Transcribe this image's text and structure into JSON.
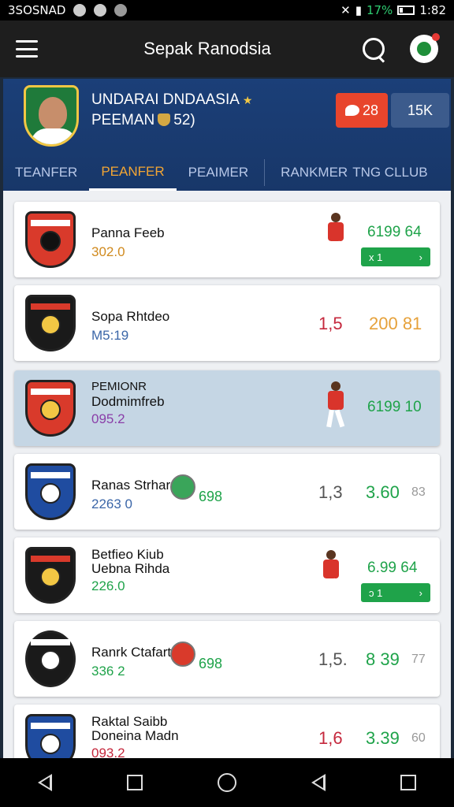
{
  "status_bar": {
    "carrier": "3SOSNAD",
    "battery_percent": "17%",
    "time": "1:82",
    "icons": [
      "notification-icon",
      "record-icon",
      "android-icon",
      "mute-icon",
      "signal-icon",
      "battery-icon"
    ]
  },
  "header": {
    "title": "Sepak Ranodsia",
    "icons": [
      "menu-icon",
      "search-icon",
      "profile-icon"
    ]
  },
  "banner": {
    "line1": "UNDARAI DNDAASIA",
    "line2_prefix": "PEEMAN",
    "line2_suffix": "52)",
    "twitter_count": "28",
    "follow_label": "15K"
  },
  "tabs": [
    {
      "label": "TEANFER",
      "active": false
    },
    {
      "label": "PEANFER",
      "active": true
    },
    {
      "label": "PEAIMER",
      "active": false
    },
    {
      "label": "RANKMER",
      "active": false
    },
    {
      "label": "TNG CLLUB",
      "active": false
    }
  ],
  "cards": [
    {
      "name1": "Panna Feeb",
      "name2": "",
      "sub": "302.0",
      "sub_color": "#d08a1e",
      "stat1": "",
      "stat2": "6199 64",
      "stat2_color": "#1fa34a",
      "pill": "x 1",
      "icon": "player-icon",
      "crest_color": "#d93a2b"
    },
    {
      "name1": "Sopa Rhtdeo",
      "name2": "",
      "sub": "M5:19",
      "sub_color": "#3b66a8",
      "stat1": "1,5",
      "stat1_color": "#c5283d",
      "stat2": "200 81",
      "stat2_color": "#e6a13a",
      "pill": "",
      "icon": "",
      "crest_color": "#1a1a1a"
    },
    {
      "name1": "PEMIONR",
      "name2": "Dodmimfreb",
      "sub": "095.2",
      "sub_color": "#8a3ea8",
      "stat1": "",
      "stat2": "6199 10",
      "stat2_color": "#1fa34a",
      "pill": "",
      "icon": "player-icon",
      "crest_color": "#d93a2b"
    },
    {
      "name1": "Ranas Strhar",
      "name2": "",
      "sub": "2263 0",
      "sub_color": "#3b66a8",
      "stat1": "1,3",
      "stat1_color": "#555555",
      "stat2": "3.60",
      "stat2_color": "#1fa34a",
      "stat3": "83",
      "mid": "698",
      "pill": "",
      "icon": "ball-icon",
      "crest_color": "#1f4ca0"
    },
    {
      "name1": "Betfieo Kiub",
      "name2": "Uebna Rihda",
      "sub": "226.0",
      "sub_color": "#1fa34a",
      "stat1": "",
      "stat2": "6.99 64",
      "stat2_color": "#1fa34a",
      "pill": "ɔ 1",
      "icon": "player-icon",
      "crest_color": "#1a1a1a"
    },
    {
      "name1": "Ranrk Ctafart",
      "name2": "",
      "sub": "336 2",
      "sub_color": "#1fa34a",
      "stat1": "1,5.",
      "stat1_color": "#555555",
      "stat2": "8 39",
      "stat2_color": "#1fa34a",
      "stat3": "77",
      "mid": "698",
      "pill": "",
      "icon": "ball-icon",
      "crest_color": "#1a1a1a"
    },
    {
      "name1": "Raktal Saibb",
      "name2": "Doneina Madn",
      "sub": "093.2",
      "sub_color": "#c5283d",
      "stat1": "1,6",
      "stat1_color": "#c5283d",
      "stat2": "3.39",
      "stat2_color": "#1fa34a",
      "stat3": "60",
      "pill": "",
      "icon": "",
      "crest_color": "#1f4ca0"
    }
  ],
  "nav": [
    "back-icon",
    "recents-icon",
    "home-icon",
    "back-icon",
    "recents-icon"
  ]
}
